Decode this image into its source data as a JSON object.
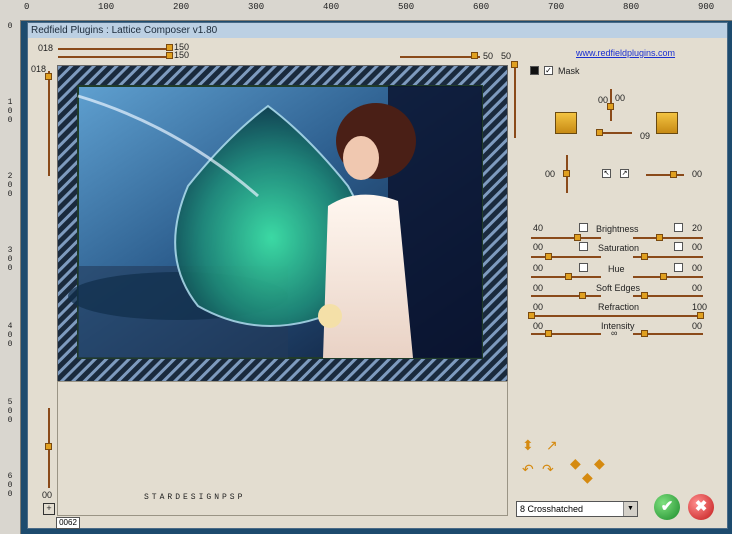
{
  "ruler": {
    "top_labels": [
      "0",
      "100",
      "200",
      "300",
      "400",
      "500",
      "600",
      "700",
      "800",
      "900"
    ],
    "left_labels": [
      "1\n0\n0",
      "2\n0\n0",
      "3\n0\n0",
      "4\n0\n0",
      "5\n0\n0",
      "6\n0\n0"
    ],
    "left_first": "0"
  },
  "window": {
    "title": "Redfield Plugins : Lattice Composer v1.80",
    "link": "www.redfieldplugins.com"
  },
  "top_controls": {
    "left_value": "018",
    "left_value2": "018",
    "x1": "150",
    "x2": "150",
    "right_val": "50",
    "right_val2": "50"
  },
  "mask": {
    "label": "Mask"
  },
  "controls": {
    "rot_top": "00",
    "rot_top2": "00",
    "rot_right": "09",
    "pos_left": "00",
    "pos_right": "00"
  },
  "rows": [
    {
      "left": "40",
      "label": "Brightness",
      "right": "20"
    },
    {
      "left": "00",
      "label": "Saturation",
      "right": "00"
    },
    {
      "left": "00",
      "label": "Hue",
      "right": "00"
    },
    {
      "left": "00",
      "label": "Soft Edges",
      "right": "00"
    },
    {
      "left": "00",
      "label": "Refraction",
      "right": "100"
    },
    {
      "left": "00",
      "label": "Intensity",
      "right": "00"
    }
  ],
  "bottom": {
    "left_value": "00",
    "status": "0062",
    "watermark": "STARDESIGNPSP",
    "dropdown": "8 Crosshatched",
    "ok": "✔",
    "cancel": "✖"
  }
}
